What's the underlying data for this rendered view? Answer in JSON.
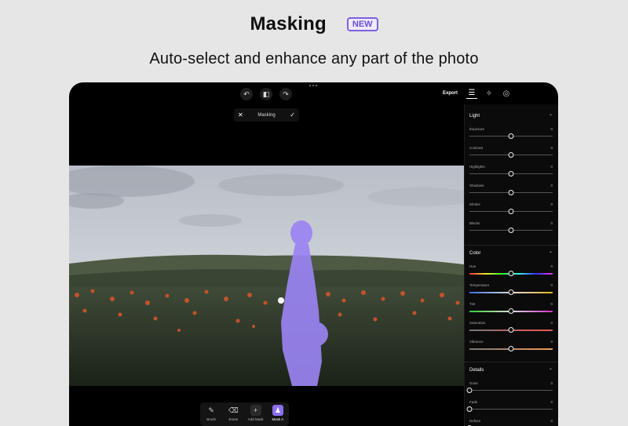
{
  "headline": {
    "title": "Masking",
    "badge": "NEW"
  },
  "subtitle": "Auto-select and enhance any part of the photo",
  "toolbar": {
    "export_label": "Export",
    "undo_icon": "undo-icon",
    "compare_icon": "compare-icon",
    "redo_icon": "redo-icon",
    "panel_tabs": [
      "adjust-sliders-icon",
      "magic-wand-icon",
      "layers-icon"
    ]
  },
  "mask_bar": {
    "cancel": "✕",
    "label": "Masking",
    "confirm": "✓"
  },
  "bottom_tools": [
    {
      "label": "Brush",
      "icon": "brush-icon",
      "glyph": "✎",
      "active": false
    },
    {
      "label": "Erase",
      "icon": "eraser-icon",
      "glyph": "⌫",
      "active": false
    },
    {
      "label": "Add Mask",
      "icon": "plus-icon",
      "glyph": "+",
      "active": false
    },
    {
      "label": "Mask A",
      "icon": "mask-person-icon",
      "glyph": "♟",
      "active": true
    }
  ],
  "panel": {
    "sections": [
      {
        "title": "Light",
        "sliders": [
          {
            "label": "Exposure",
            "value": "0",
            "level": 0.5
          },
          {
            "label": "Contrast",
            "value": "0",
            "level": 0.5
          },
          {
            "label": "Highlights",
            "value": "0",
            "level": 0.5
          },
          {
            "label": "Shadows",
            "value": "0",
            "level": 0.5
          },
          {
            "label": "Whites",
            "value": "0",
            "level": 0.5
          },
          {
            "label": "Blacks",
            "value": "0",
            "level": 0.5
          }
        ]
      },
      {
        "title": "Color",
        "sliders": [
          {
            "label": "Hue",
            "value": "0",
            "level": 0.5,
            "gradient": "hue"
          },
          {
            "label": "Temperature",
            "value": "0",
            "level": 0.5,
            "gradient": "temp"
          },
          {
            "label": "Tint",
            "value": "0",
            "level": 0.5,
            "gradient": "tint"
          },
          {
            "label": "Saturation",
            "value": "0",
            "level": 0.5,
            "gradient": "sat"
          },
          {
            "label": "Vibrance",
            "value": "0",
            "level": 0.5,
            "gradient": "vib"
          }
        ]
      },
      {
        "title": "Details",
        "sliders": [
          {
            "label": "Grain",
            "value": "0",
            "level": 0
          },
          {
            "label": "Fade",
            "value": "0",
            "level": 0
          },
          {
            "label": "Defaze",
            "value": "0",
            "level": 0
          }
        ]
      }
    ]
  },
  "colors": {
    "accent": "#8a6ef0",
    "mask": "#9a84f2",
    "background": "#e6e6e6"
  }
}
